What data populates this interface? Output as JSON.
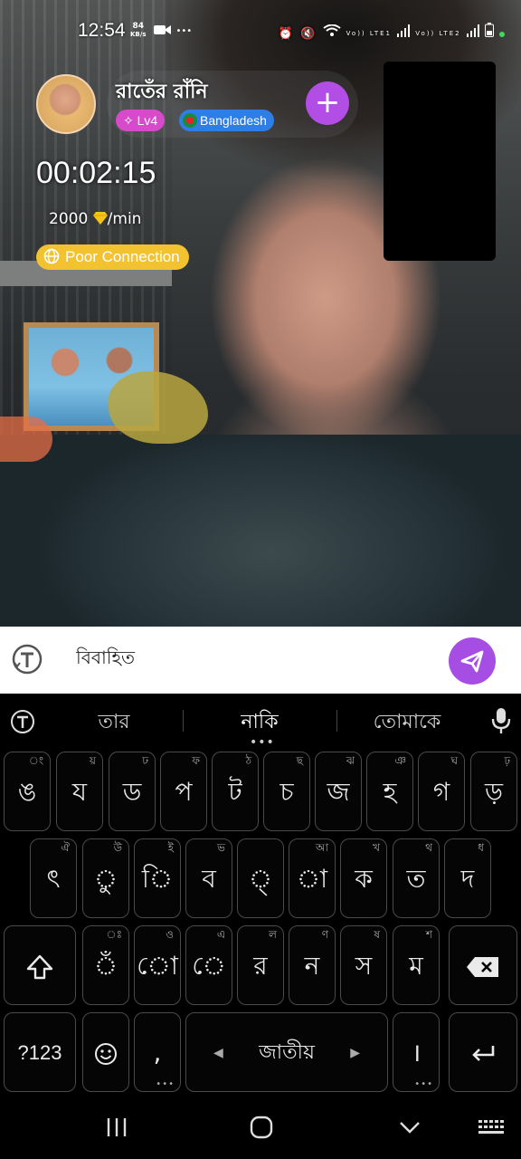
{
  "status_bar": {
    "time": "12:54",
    "net_speed": "84",
    "net_unit": "KB/s",
    "sim1": "Vo)) LTE1",
    "sim2": "Vo)) LTE2"
  },
  "host": {
    "name": "রাতেঁর রাঁনি",
    "level": "Lv4",
    "country": "Bangladesh",
    "follow_label": "+"
  },
  "call": {
    "timer": "00:02:15",
    "rate_value": "2000",
    "rate_unit": "/min",
    "connection_status": "Poor Connection"
  },
  "input": {
    "value": "বিবাহিত"
  },
  "keyboard": {
    "suggestions": [
      "তার",
      "নাকি",
      "তোমাকে"
    ],
    "row1": [
      {
        "label": "ঙ",
        "hint": "ং"
      },
      {
        "label": "য",
        "hint": "য়"
      },
      {
        "label": "ড",
        "hint": "ঢ"
      },
      {
        "label": "প",
        "hint": "ফ"
      },
      {
        "label": "ট",
        "hint": "ঠ"
      },
      {
        "label": "চ",
        "hint": "ছ"
      },
      {
        "label": "জ",
        "hint": "ঝ"
      },
      {
        "label": "হ",
        "hint": "ঞ"
      },
      {
        "label": "গ",
        "hint": "ঘ"
      },
      {
        "label": "ড়",
        "hint": "ঢ়"
      }
    ],
    "row2": [
      {
        "label": "ৎ",
        "hint": "ঐ"
      },
      {
        "label": "ু",
        "hint": "উ"
      },
      {
        "label": "ি",
        "hint": "ই"
      },
      {
        "label": "ব",
        "hint": "ভ"
      },
      {
        "label": "্",
        "hint": ""
      },
      {
        "label": "া",
        "hint": "আ"
      },
      {
        "label": "ক",
        "hint": "খ"
      },
      {
        "label": "ত",
        "hint": "থ"
      },
      {
        "label": "দ",
        "hint": "ধ"
      }
    ],
    "row3": [
      {
        "label": "ঁ",
        "hint": "ঃ"
      },
      {
        "label": "ো",
        "hint": "ও"
      },
      {
        "label": "ে",
        "hint": "এ"
      },
      {
        "label": "র",
        "hint": "ল"
      },
      {
        "label": "ন",
        "hint": "ণ"
      },
      {
        "label": "স",
        "hint": "ষ"
      },
      {
        "label": "ম",
        "hint": "শ"
      }
    ],
    "symbols_label": "?123",
    "comma_label": ",",
    "space_label": "জাতীয়",
    "space_left": "◀",
    "space_right": "▶",
    "period_label": "।"
  },
  "colors": {
    "accent_purple": "#a64ee4",
    "level_badge": "#d54bc9",
    "country_badge": "#2f7ee6",
    "poor_connection": "#f2c230"
  }
}
